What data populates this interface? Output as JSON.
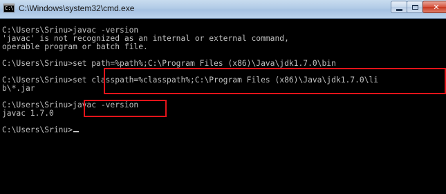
{
  "window": {
    "title": "C:\\Windows\\system32\\cmd.exe",
    "icon": "cmd-icon",
    "icon_glyph": "C:\\",
    "buttons": {
      "minimize": "minimize-icon",
      "maximize": "maximize-icon",
      "close_label": "✕"
    }
  },
  "console": {
    "lines": [
      "C:\\Users\\Srinu>javac -version",
      "'javac' is not recognized as an internal or external command,",
      "operable program or batch file.",
      "C:\\Users\\Srinu>set path=%path%;C:\\Program Files (x86)\\Java\\jdk1.7.0\\bin",
      "C:\\Users\\Srinu>set classpath=%classpath%;C:\\Program Files (x86)\\Java\\jdk1.7.0\\li",
      "b\\*.jar",
      "C:\\Users\\Srinu>javac -version",
      "javac 1.7.0",
      "C:\\Users\\Srinu>"
    ]
  },
  "colors": {
    "console_background": "#000000",
    "console_text": "#c0c0c0",
    "highlight": "#e3141a"
  }
}
